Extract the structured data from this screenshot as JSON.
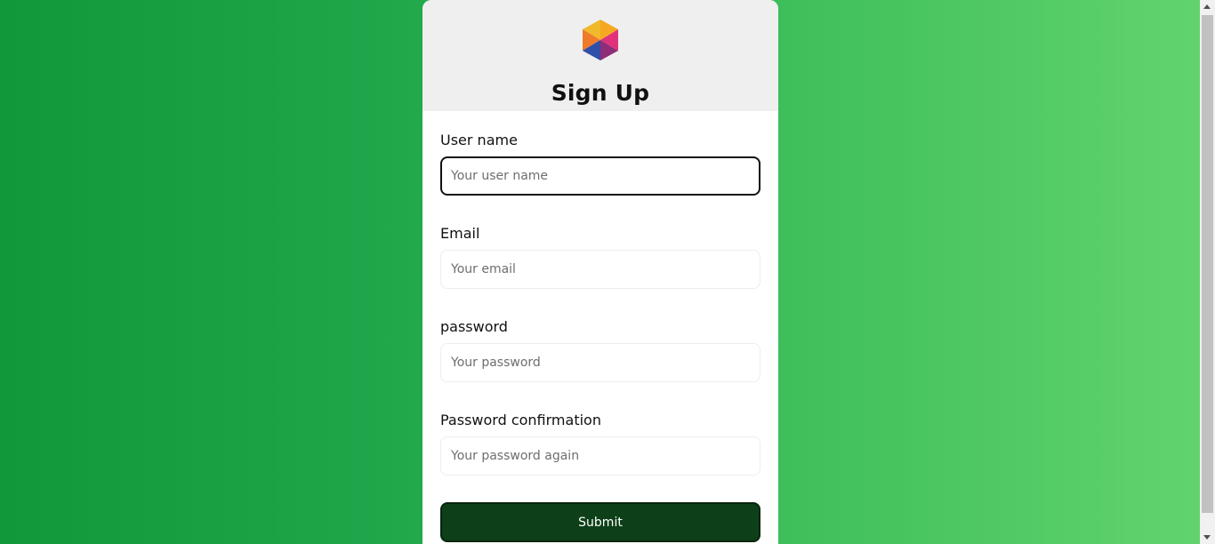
{
  "form": {
    "title": "Sign Up",
    "fields": [
      {
        "label": "User name",
        "placeholder": "Your user name",
        "value": ""
      },
      {
        "label": "Email",
        "placeholder": "Your email",
        "value": ""
      },
      {
        "label": "password",
        "placeholder": "Your password",
        "value": ""
      },
      {
        "label": "Password confirmation",
        "placeholder": "Your password again",
        "value": ""
      }
    ],
    "submit_label": "Submit"
  },
  "colors": {
    "background_start": "#11983a",
    "background_end": "#63d46e",
    "submit_bg": "#0d4019",
    "header_bg": "#efefef"
  },
  "icons": {
    "logo": "hexagon-logo-icon"
  }
}
